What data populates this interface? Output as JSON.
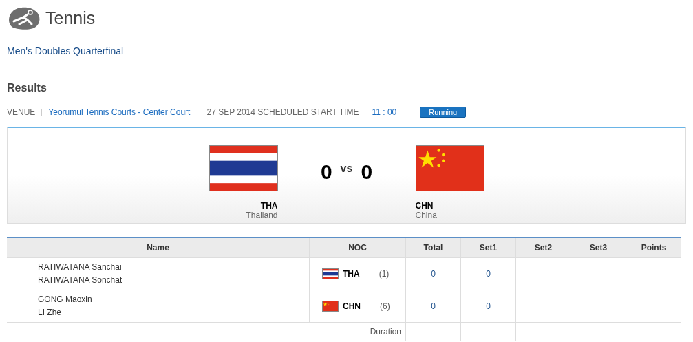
{
  "sport": {
    "title": "Tennis"
  },
  "event": "Men's Doubles Quarterfinal",
  "section_title": "Results",
  "info": {
    "venue_label": "VENUE",
    "venue": "Yeorumul Tennis Courts - Center Court",
    "schedule": "27 SEP 2014 SCHEDULED START TIME",
    "time": "11 : 00",
    "status": "Running"
  },
  "match": {
    "home": {
      "flag": {
        "kind": "tha"
      },
      "code": "THA",
      "country": "Thailand",
      "score": "0"
    },
    "vs": "vs",
    "away": {
      "flag": {
        "kind": "chn"
      },
      "code": "CHN",
      "country": "China",
      "score": "0"
    }
  },
  "table": {
    "columns": [
      "Name",
      "NOC",
      "Total",
      "Set1",
      "Set2",
      "Set3",
      "Points"
    ],
    "rows": [
      {
        "players": [
          "RATIWATANA Sanchai",
          "RATIWATANA Sonchat"
        ],
        "flag": {
          "kind": "tha"
        },
        "noc": "THA",
        "seed": "(1)",
        "total": "0",
        "sets": [
          "0"
        ]
      },
      {
        "players": [
          "GONG Maoxin",
          "LI Zhe"
        ],
        "flag": {
          "kind": "chn"
        },
        "noc": "CHN",
        "seed": "(6)",
        "total": "0",
        "sets": [
          "0"
        ]
      }
    ],
    "footer_label": "Duration"
  }
}
